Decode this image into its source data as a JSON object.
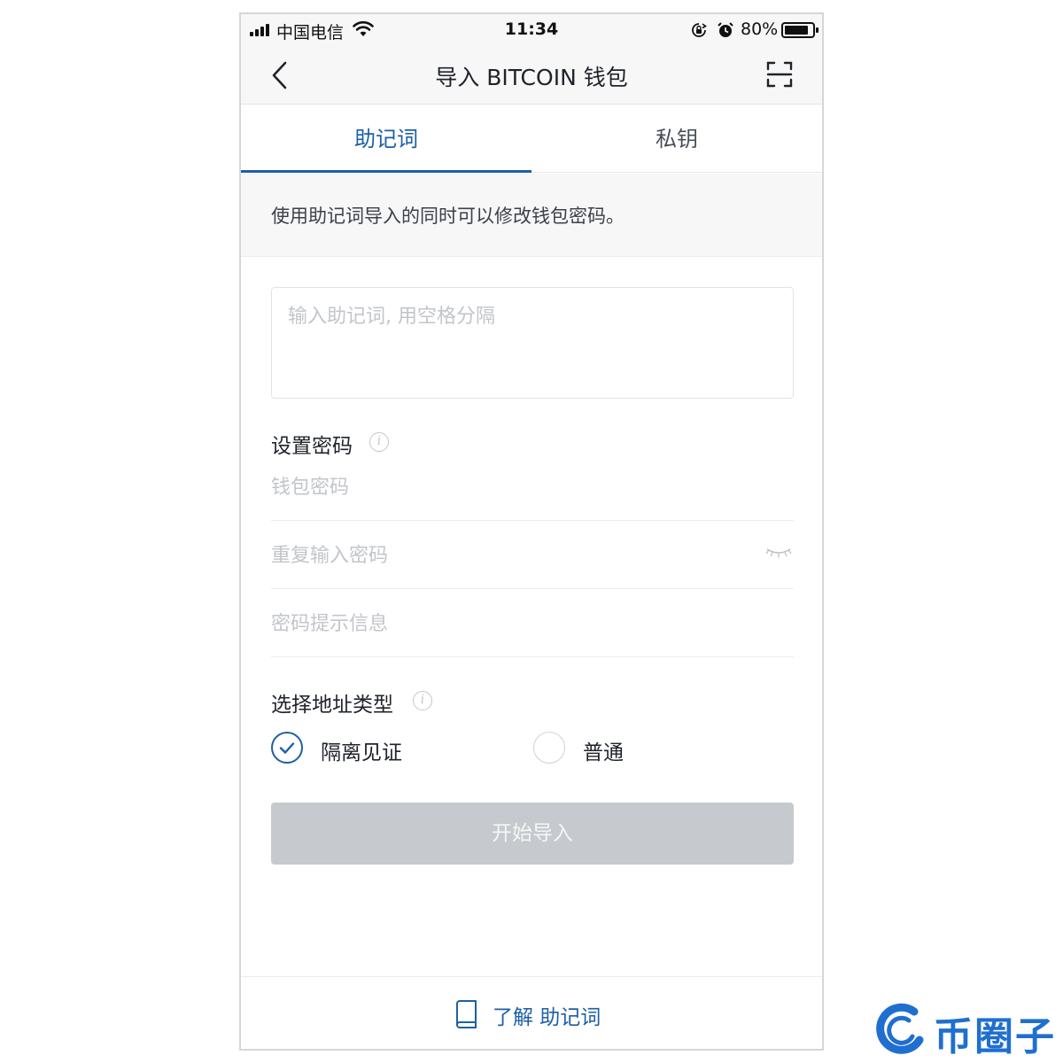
{
  "status_bar": {
    "carrier": "中国电信",
    "time": "11:34",
    "battery": "80%"
  },
  "nav": {
    "title": "导入 BITCOIN 钱包",
    "icons": {
      "back": "chevron-left-icon",
      "scan": "scan-icon"
    }
  },
  "tabs": [
    {
      "label": "助记词",
      "active": true
    },
    {
      "label": "私钥",
      "active": false
    }
  ],
  "info_banner": "使用助记词导入的同时可以修改钱包密码。",
  "mnemonic": {
    "placeholder": "输入助记词, 用空格分隔",
    "value": ""
  },
  "password_section": {
    "label": "设置密码",
    "password_placeholder": "钱包密码",
    "repeat_placeholder": "重复输入密码",
    "hint_placeholder": "密码提示信息"
  },
  "address_type": {
    "label": "选择地址类型",
    "options": [
      {
        "label": "隔离见证",
        "selected": true
      },
      {
        "label": "普通",
        "selected": false
      }
    ]
  },
  "start_button": "开始导入",
  "footer_link": "了解 助记词",
  "colors": {
    "accent": "#1d5fa6",
    "button_disabled": "#c6c9cd",
    "background_gray": "#f7f7f8"
  },
  "watermark": "币圈子"
}
